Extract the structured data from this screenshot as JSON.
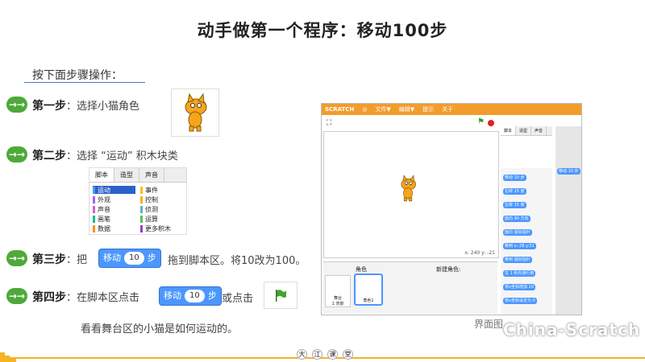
{
  "title": "动手做第一个程序：移动100步",
  "subtitle": "按下面步骤操作：",
  "step_icon": "→→",
  "steps": [
    {
      "label": "第一步",
      "text": "：选择小猫角色"
    },
    {
      "label": "第二步",
      "text": "：选择 “运动” 积木块类"
    },
    {
      "label": "第三步",
      "text_a": "：把",
      "text_b": "拖到脚本区。将10改为100。"
    },
    {
      "label": "第四步",
      "text_a": "：在脚本区点击",
      "text_b": "或点击",
      "text_c": "看看舞台区的小猫是如何运动的。"
    }
  ],
  "block": {
    "label": "移动",
    "value": "10",
    "unit": "步"
  },
  "palette": {
    "tabs": [
      "脚本",
      "造型",
      "声音"
    ],
    "left": [
      {
        "name": "运动",
        "color": "#4c97ff",
        "selected": true
      },
      {
        "name": "外观",
        "color": "#9966ff"
      },
      {
        "name": "声音",
        "color": "#cf63cf"
      },
      {
        "name": "画笔",
        "color": "#0fbd8c"
      },
      {
        "name": "数据",
        "color": "#ff8c1a"
      }
    ],
    "right": [
      {
        "name": "事件",
        "color": "#ffbf00"
      },
      {
        "name": "控制",
        "color": "#ffab19"
      },
      {
        "name": "侦测",
        "color": "#5cb1d6"
      },
      {
        "name": "运算",
        "color": "#59c059"
      },
      {
        "name": "更多积木",
        "color": "#9b3cc2"
      }
    ]
  },
  "editor": {
    "menu": [
      "文件▼",
      "编辑▼",
      "提示",
      "关于"
    ],
    "logo": "SCRATCH",
    "coords": "x: 240  y: -21",
    "sprites_label": "角色",
    "new_sprite": "新建角色:",
    "stage_label": "舞台\n1 背景",
    "sprite_name": "角色1",
    "blocks": [
      "移动 10 步",
      "右转 15 度",
      "左转 15 度",
      "面向 90 方向",
      "面向 鼠标指针",
      "移到 x:-28 y:31",
      "移到 鼠标指针",
      "在 1 秒内滑行到",
      "将x坐标增加 10",
      "将x坐标设定为 0"
    ],
    "script_block": "移动 10 步"
  },
  "caption_fragment": "界面图",
  "watermark": "China-Scratch",
  "footer": [
    "大",
    "江",
    "课",
    "堂"
  ]
}
